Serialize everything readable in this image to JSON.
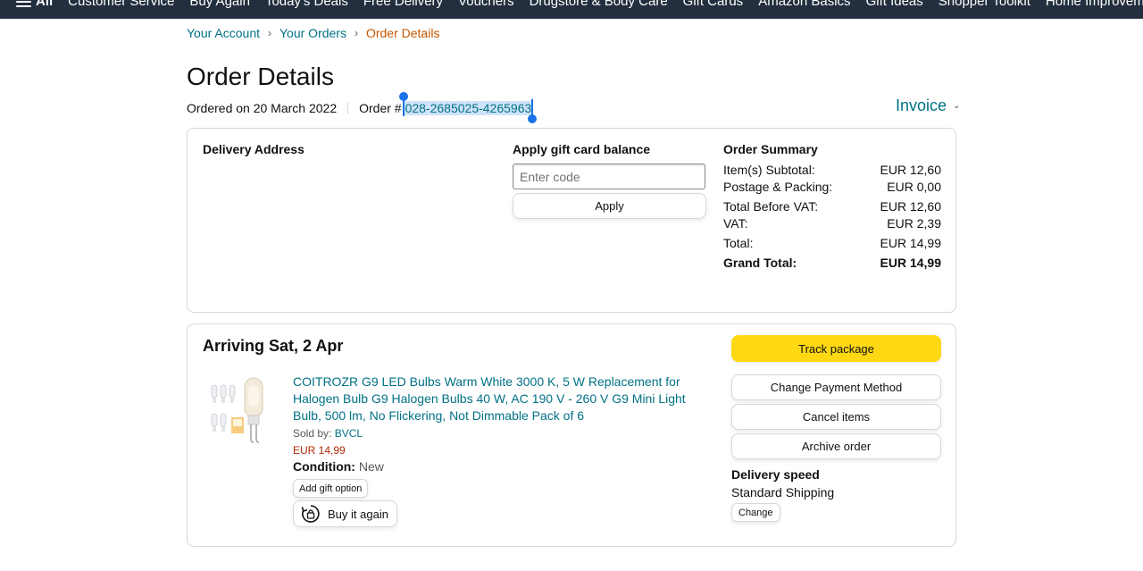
{
  "nav": {
    "all_label": "All",
    "items": [
      "Customer Service",
      "Buy Again",
      "Today's Deals",
      "Free Delivery",
      "Vouchers",
      "Drugstore & Body Care",
      "Gift Cards",
      "Amazon Basics",
      "Gift Ideas",
      "Shopper Toolkit",
      "Home Improvement"
    ]
  },
  "breadcrumb": {
    "items": [
      "Your Account",
      "Your Orders",
      "Order Details"
    ],
    "separator": "›"
  },
  "page": {
    "title": "Order Details",
    "ordered_on": "Ordered on 20 March 2022",
    "order_label": "Order #",
    "order_id": "028-2685025-4265963",
    "invoice_label": "Invoice",
    "invoice_caret": "⌄"
  },
  "delivery": {
    "title": "Delivery Address"
  },
  "gift_card": {
    "title": "Apply gift card balance",
    "placeholder": "Enter code",
    "apply_label": "Apply"
  },
  "summary": {
    "title": "Order Summary",
    "rows": [
      {
        "label": "Item(s) Subtotal:",
        "value": "EUR 12,60"
      },
      {
        "label": "Postage & Packing:",
        "value": "EUR 0,00"
      },
      {
        "label": "Total Before VAT:",
        "value": "EUR 12,60"
      },
      {
        "label": "VAT:",
        "value": "EUR 2,39"
      },
      {
        "label": "Total:",
        "value": "EUR 14,99"
      },
      {
        "label": "Grand Total:",
        "value": "EUR 14,99"
      }
    ]
  },
  "shipment": {
    "arriving": "Arriving Sat, 2 Apr",
    "product_title": "COITROZR G9 LED Bulbs Warm White 3000 K, 5 W Replacement for Halogen Bulb G9 Halogen Bulbs 40 W, AC 190 V - 260 V G9 Mini Light Bulb, 500 lm, No Flickering, Not Dimmable Pack of 6",
    "sold_by_label": "Sold by:",
    "seller": "BVCL",
    "price": "EUR 14,99",
    "condition_label": "Condition:",
    "condition_value": "New",
    "gift_option_label": "Add gift option",
    "buy_again_label": "Buy it again",
    "actions": {
      "track": "Track package",
      "change_payment": "Change Payment Method",
      "cancel": "Cancel items",
      "archive": "Archive order"
    },
    "delivery_speed_title": "Delivery speed",
    "delivery_speed_value": "Standard Shipping",
    "change_label": "Change"
  },
  "colors": {
    "nav_bg": "#232f3e",
    "link": "#007185",
    "breadcrumb_current": "#c45500",
    "price": "#b12704",
    "primary_button": "#ffd814",
    "selection_handle": "#1a73e8"
  }
}
